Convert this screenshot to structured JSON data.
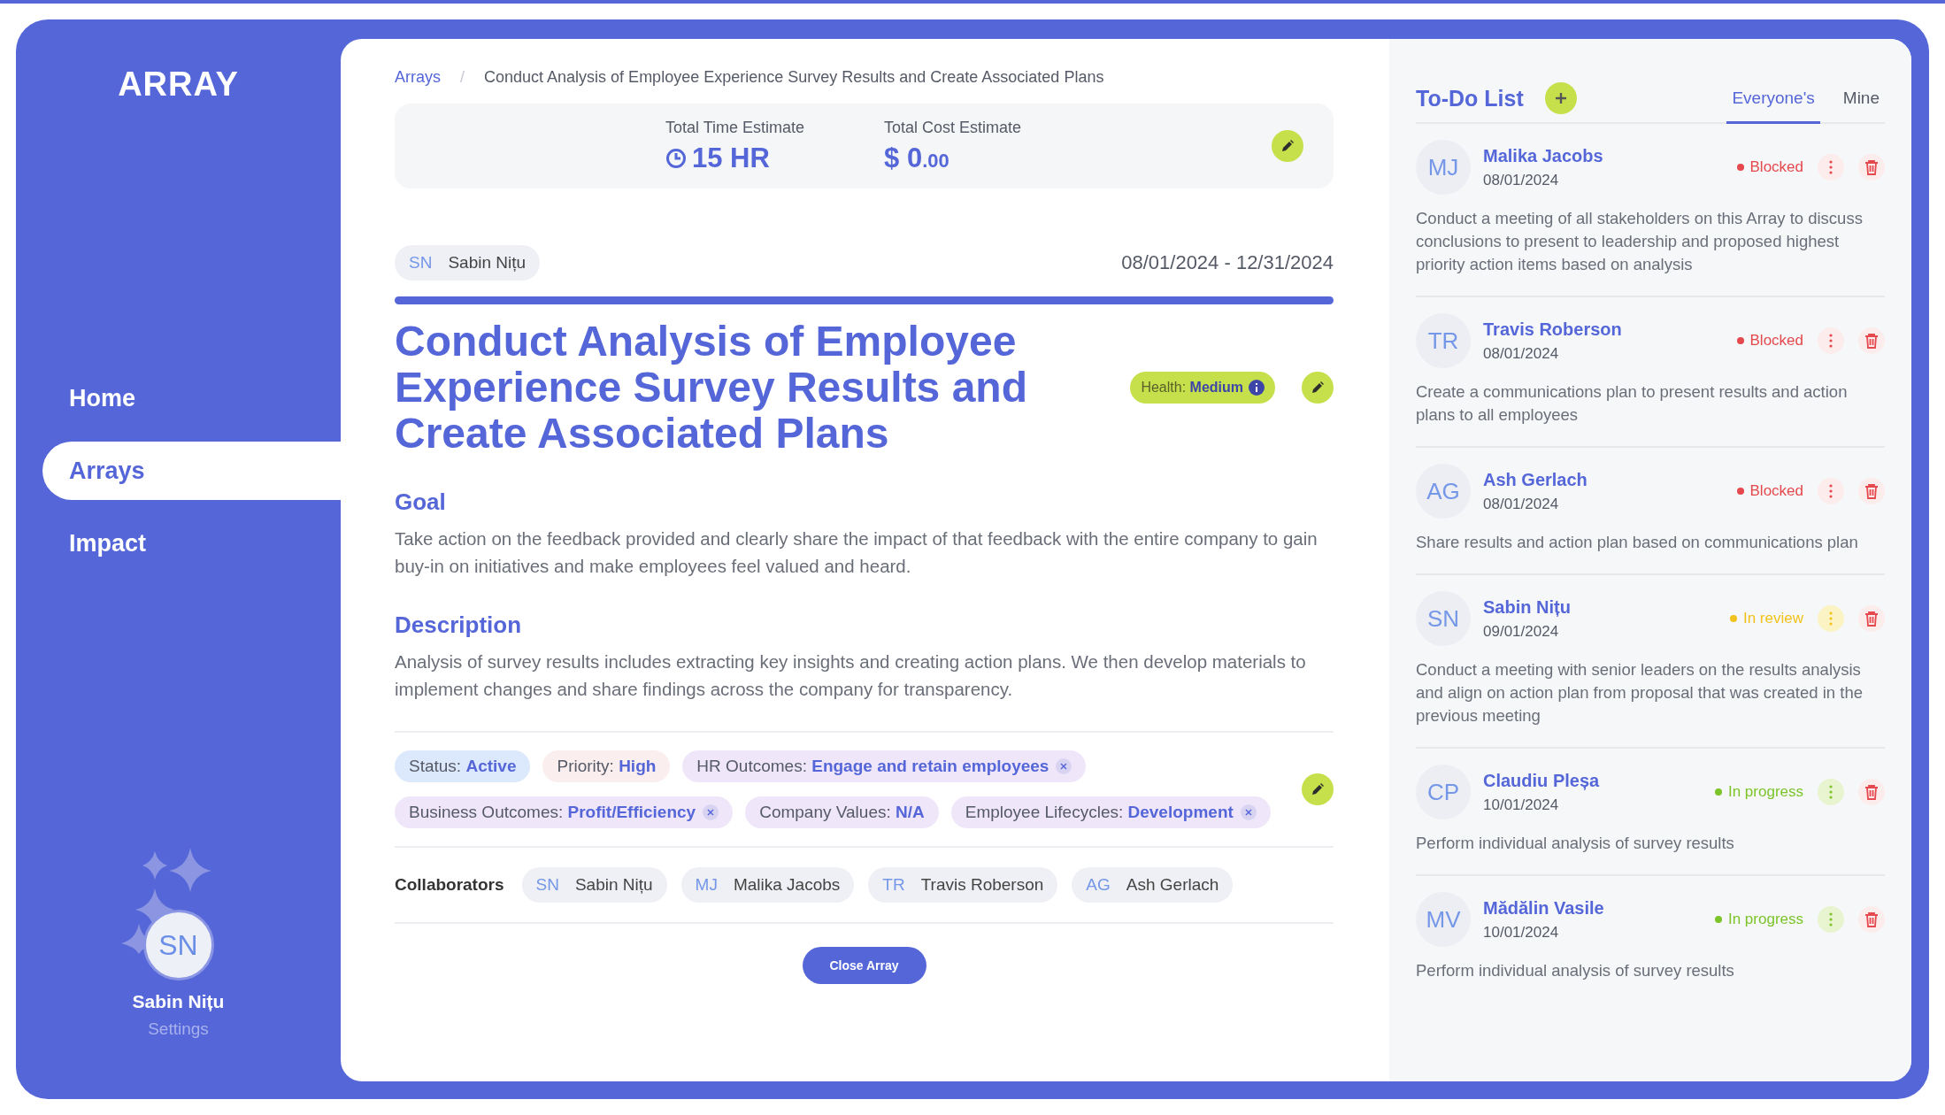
{
  "sidebar": {
    "logo": "ARRAY",
    "nav": [
      {
        "label": "Home",
        "selected": false
      },
      {
        "label": "Arrays",
        "selected": true
      },
      {
        "label": "Impact",
        "selected": false
      }
    ],
    "user": {
      "initials": "SN",
      "name": "Sabin Nițu",
      "link": "Settings"
    }
  },
  "breadcrumb_separator": "/",
  "breadcrumb": [
    "Arrays",
    "Conduct Analysis of Employee Experience Survey Results and Create Associated Plans"
  ],
  "estimates": [
    {
      "kind": "time",
      "label": "Total Time Estimate",
      "value": "15 HR"
    },
    {
      "kind": "cost",
      "label": "Total Cost Estimate",
      "value": "$ 0",
      "fraction": ".00"
    }
  ],
  "owner": {
    "initials": "SN",
    "name": "Sabin Nițu"
  },
  "dates": "08/01/2024 - 12/31/2024",
  "title": "Conduct Analysis of Employee Experience Survey Results and Create Associated Plans",
  "health": {
    "label": "Health:",
    "value": "Medium"
  },
  "sections": [
    {
      "heading": "Goal",
      "text": "Take action on the feedback provided and clearly share the impact of that feedback with the entire company to gain buy-in on initiatives and make employees feel valued and heard."
    },
    {
      "heading": "Description",
      "text": "Analysis of survey results includes extracting key insights and creating action plans. We then develop materials to implement changes and share findings across the company for transparency."
    }
  ],
  "tags": [
    {
      "label": "Status:",
      "value": "Active",
      "color": "#dce8fb",
      "removable": false
    },
    {
      "label": "Priority:",
      "value": "High",
      "color": "#fbeeee",
      "removable": false
    },
    {
      "label": "HR Outcomes:",
      "value": "Engage and retain employees",
      "color": "#efe6fa",
      "removable": true
    },
    {
      "label": "Business Outcomes:",
      "value": "Profit/Efficiency",
      "color": "#efe6fa",
      "removable": true
    },
    {
      "label": "Company Values:",
      "value": "N/A",
      "color": "#efe6fa",
      "removable": false
    },
    {
      "label": "Employee Lifecycles:",
      "value": "Development",
      "color": "#efe6fa",
      "removable": true
    }
  ],
  "collaborators": {
    "label": "Collaborators",
    "people": [
      {
        "initials": "SN",
        "name": "Sabin Nițu"
      },
      {
        "initials": "MJ",
        "name": "Malika Jacobs"
      },
      {
        "initials": "TR",
        "name": "Travis Roberson"
      },
      {
        "initials": "AG",
        "name": "Ash Gerlach"
      }
    ]
  },
  "close_button": "Close Array",
  "todo": {
    "title": "To-Do List",
    "tabs": [
      {
        "label": "Everyone's",
        "selected": true
      },
      {
        "label": "Mine",
        "selected": false
      }
    ],
    "items": [
      {
        "initials": "MJ",
        "name": "Malika Jacobs",
        "date": "08/01/2024",
        "status": "Blocked",
        "kind": "blocked",
        "text": "Conduct a meeting of all stakeholders on this Array to discuss conclusions to present to leadership and proposed highest priority action items based on analysis"
      },
      {
        "initials": "TR",
        "name": "Travis Roberson",
        "date": "08/01/2024",
        "status": "Blocked",
        "kind": "blocked",
        "text": "Create a communications plan to present results and action plans to all employees"
      },
      {
        "initials": "AG",
        "name": "Ash Gerlach",
        "date": "08/01/2024",
        "status": "Blocked",
        "kind": "blocked",
        "text": "Share results and action plan based on communications plan"
      },
      {
        "initials": "SN",
        "name": "Sabin Nițu",
        "date": "09/01/2024",
        "status": "In review",
        "kind": "review",
        "text": "Conduct a meeting with senior leaders on the results analysis and align on action plan from proposal that was created in the previous meeting"
      },
      {
        "initials": "CP",
        "name": "Claudiu Pleșa",
        "date": "10/01/2024",
        "status": "In progress",
        "kind": "progress",
        "text": "Perform individual analysis of survey results"
      },
      {
        "initials": "MV",
        "name": "Mădălin Vasile",
        "date": "10/01/2024",
        "status": "In progress",
        "kind": "progress",
        "text": "Perform individual analysis of survey results"
      }
    ]
  }
}
